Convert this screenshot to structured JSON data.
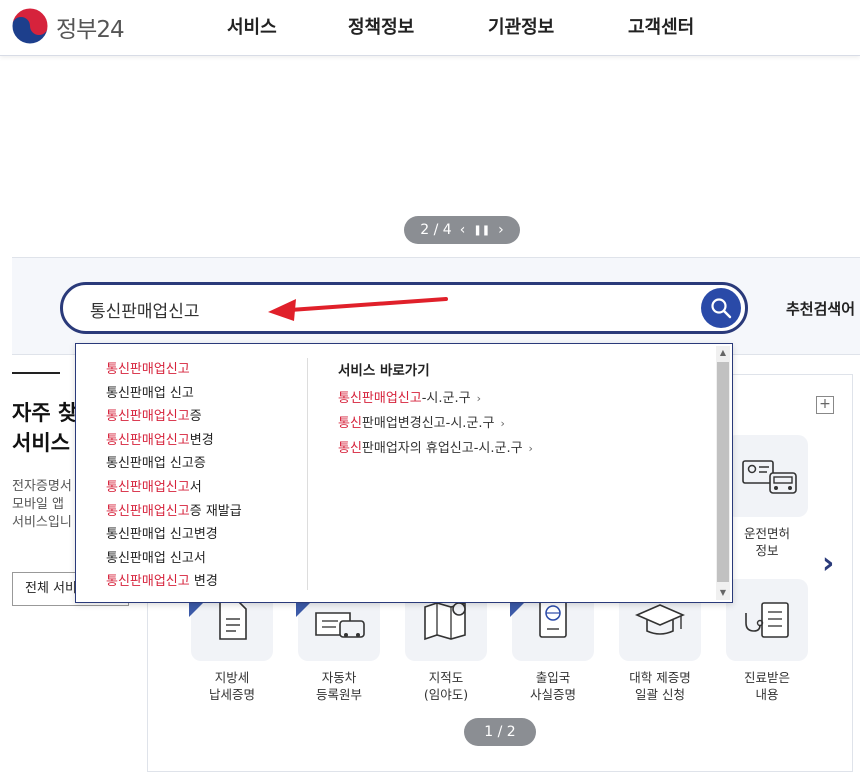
{
  "header": {
    "logo_text": "정부24",
    "nav": [
      "서비스",
      "정책정보",
      "기관정보",
      "고객센터"
    ]
  },
  "banner": {
    "pager_text": "2 / 4"
  },
  "search": {
    "value": "통신판매업신고",
    "recommend_label": "추천검색어"
  },
  "faq": {
    "title_line1": "자주 찾",
    "title_line2": "서비스",
    "desc_line1": "전자증명서",
    "desc_line2": "모바일 앱",
    "desc_line3": "서비스입니",
    "all_button": "전체 서비스"
  },
  "suggestions": [
    {
      "hl": "통신판매업신고",
      "rest": ""
    },
    {
      "hl": "",
      "rest": "통신판매업 신고"
    },
    {
      "hl": "통신판매업신고",
      "rest": "증"
    },
    {
      "hl": "통신판매업신고",
      "rest": "변경"
    },
    {
      "hl": "",
      "rest": "통신판매업 신고증"
    },
    {
      "hl": "통신판매업신고",
      "rest": "서"
    },
    {
      "hl": "통신판매업신고",
      "rest": "증 재발급"
    },
    {
      "hl": "",
      "rest": "통신판매업 신고변경"
    },
    {
      "hl": "",
      "rest": "통신판매업 신고서"
    },
    {
      "hl": "통신판매업신고",
      "rest": " 변경"
    }
  ],
  "shortcuts": {
    "title": "서비스 바로가기",
    "items": [
      {
        "hl": "통신판매업신고",
        "rest": "-시.군.구"
      },
      {
        "hl": "통신",
        "rest": "판매업변경신고-시.군.구"
      },
      {
        "hl": "통신",
        "rest": "판매업자의 휴업신고-시.군.구"
      }
    ]
  },
  "services": {
    "top_right": {
      "line1": "운전면허",
      "line2": "정보"
    },
    "row2": [
      {
        "line1": "지방세",
        "line2": "납세증명"
      },
      {
        "line1": "자동차",
        "line2": "등록원부"
      },
      {
        "line1": "지적도",
        "line2": "(임야도)"
      },
      {
        "line1": "출입국",
        "line2": "사실증명"
      },
      {
        "line1": "대학 제증명",
        "line2": "일괄 신청"
      },
      {
        "line1": "진료받은",
        "line2": "내용"
      }
    ],
    "pager_text": "1 / 2"
  },
  "colors": {
    "accent": "#2a3a7a",
    "highlight": "#d6233c",
    "search_button": "#2a4aa8"
  }
}
